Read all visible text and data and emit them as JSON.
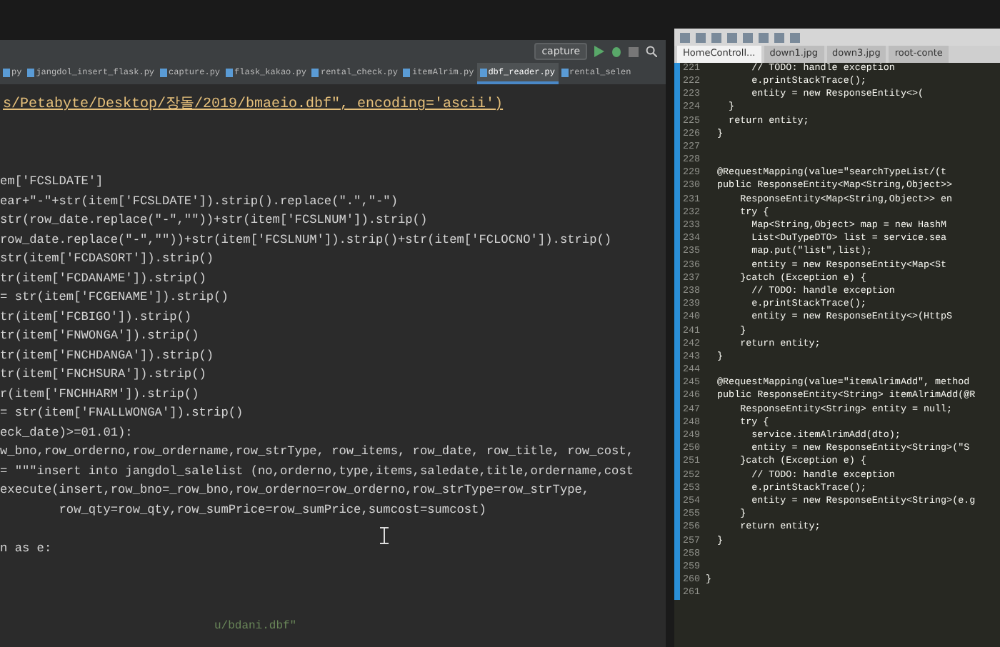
{
  "left_editor": {
    "run_config": "capture",
    "tabs": [
      {
        "label": "py",
        "selected": false
      },
      {
        "label": "jangdol_insert_flask.py",
        "selected": false
      },
      {
        "label": "capture.py",
        "selected": false
      },
      {
        "label": "flask_kakao.py",
        "selected": false
      },
      {
        "label": "rental_check.py",
        "selected": false
      },
      {
        "label": "itemAlrim.py",
        "selected": false
      },
      {
        "label": "dbf_reader.py",
        "selected": true
      },
      {
        "label": "rental_selen",
        "selected": false
      }
    ],
    "path_line": "s/Petabyte/Desktop/장돌/2019/bmaeio.dbf\", encoding='ascii')",
    "code_lines": [
      "em['FCSLDATE']",
      "ear+\"-\"+str(item['FCSLDATE']).strip().replace(\".\",\"-\")",
      "str(row_date.replace(\"-\",\"\"))+str(item['FCSLNUM']).strip()",
      "row_date.replace(\"-\",\"\"))+str(item['FCSLNUM']).strip()+str(item['FCLOCNO']).strip()",
      "str(item['FCDASORT']).strip()",
      "tr(item['FCDANAME']).strip()",
      "= str(item['FCGENAME']).strip()",
      "tr(item['FCBIGO']).strip()",
      "tr(item['FNWONGA']).strip()",
      "tr(item['FNCHDANGA']).strip()",
      "tr(item['FNCHSURA']).strip()",
      "r(item['FNCHHARM']).strip()",
      "= str(item['FNALLWONGA']).strip()",
      "eck_date)>=01.01):",
      "w_bno,row_orderno,row_ordername,row_strType, row_items, row_date, row_title, row_cost,",
      "= \"\"\"insert into jangdol_salelist (no,orderno,type,items,saledate,title,ordername,cost",
      "execute(insert,row_bno=_row_bno,row_orderno=row_orderno,row_strType=row_strType,",
      "        row_qty=row_qty,row_sumPrice=row_sumPrice,sumcost=sumcost)"
    ],
    "except_line": "n as e:",
    "footer_line": "u/bdani.dbf\""
  },
  "right_editor": {
    "tabs": [
      {
        "label": "HomeControll...",
        "selected": true
      },
      {
        "label": "down1.jpg",
        "selected": false
      },
      {
        "label": "down3.jpg",
        "selected": false
      },
      {
        "label": "root-conte",
        "selected": false
      }
    ],
    "lines": [
      {
        "number": "221",
        "code": "        // TODO: handle exception"
      },
      {
        "number": "222",
        "code": "        e.printStackTrace();"
      },
      {
        "number": "223",
        "code": "        entity = new ResponseEntity<>("
      },
      {
        "number": "224",
        "code": "    }"
      },
      {
        "number": "225",
        "code": "    return entity;"
      },
      {
        "number": "226",
        "code": "  }"
      },
      {
        "number": "227"
      },
      {
        "number": "228"
      },
      {
        "number": "229",
        "code": "  @RequestMapping(value=\"searchTypeList/(t"
      },
      {
        "number": "230",
        "code": "  public ResponseEntity<Map<String,Object>>"
      },
      {
        "number": "231",
        "code": "      ResponseEntity<Map<String,Object>> en"
      },
      {
        "number": "232",
        "code": "      try {"
      },
      {
        "number": "233",
        "code": "        Map<String,Object> map = new HashM"
      },
      {
        "number": "234",
        "code": "        List<DuTypeDTO> list = service.sea"
      },
      {
        "number": "235",
        "code": "        map.put(\"list\",list);"
      },
      {
        "number": "236",
        "code": "        entity = new ResponseEntity<Map<St"
      },
      {
        "number": "237",
        "code": "      }catch (Exception e) {"
      },
      {
        "number": "238",
        "code": "        // TODO: handle exception"
      },
      {
        "number": "239",
        "code": "        e.printStackTrace();"
      },
      {
        "number": "240",
        "code": "        entity = new ResponseEntity<>(HttpS"
      },
      {
        "number": "241",
        "code": "      }"
      },
      {
        "number": "242",
        "code": "      return entity;"
      },
      {
        "number": "243",
        "code": "  }"
      },
      {
        "number": "244"
      },
      {
        "number": "245",
        "code": "  @RequestMapping(value=\"itemAlrimAdd\", method"
      },
      {
        "number": "246",
        "code": "  public ResponseEntity<String> itemAlrimAdd(@R"
      },
      {
        "number": "247",
        "code": "      ResponseEntity<String> entity = null;"
      },
      {
        "number": "248",
        "code": "      try {"
      },
      {
        "number": "249",
        "code": "        service.itemAlrimAdd(dto);"
      },
      {
        "number": "250",
        "code": "        entity = new ResponseEntity<String>(\"S"
      },
      {
        "number": "251",
        "code": "      }catch (Exception e) {"
      },
      {
        "number": "252",
        "code": "        // TODO: handle exception"
      },
      {
        "number": "253",
        "code": "        e.printStackTrace();"
      },
      {
        "number": "254",
        "code": "        entity = new ResponseEntity<String>(e.g"
      },
      {
        "number": "255",
        "code": "      }"
      },
      {
        "number": "256",
        "code": "      return entity;"
      },
      {
        "number": "257",
        "code": "  }"
      },
      {
        "number": "258"
      },
      {
        "number": "259"
      },
      {
        "number": "260",
        "code": "}"
      },
      {
        "number": "261"
      }
    ]
  }
}
